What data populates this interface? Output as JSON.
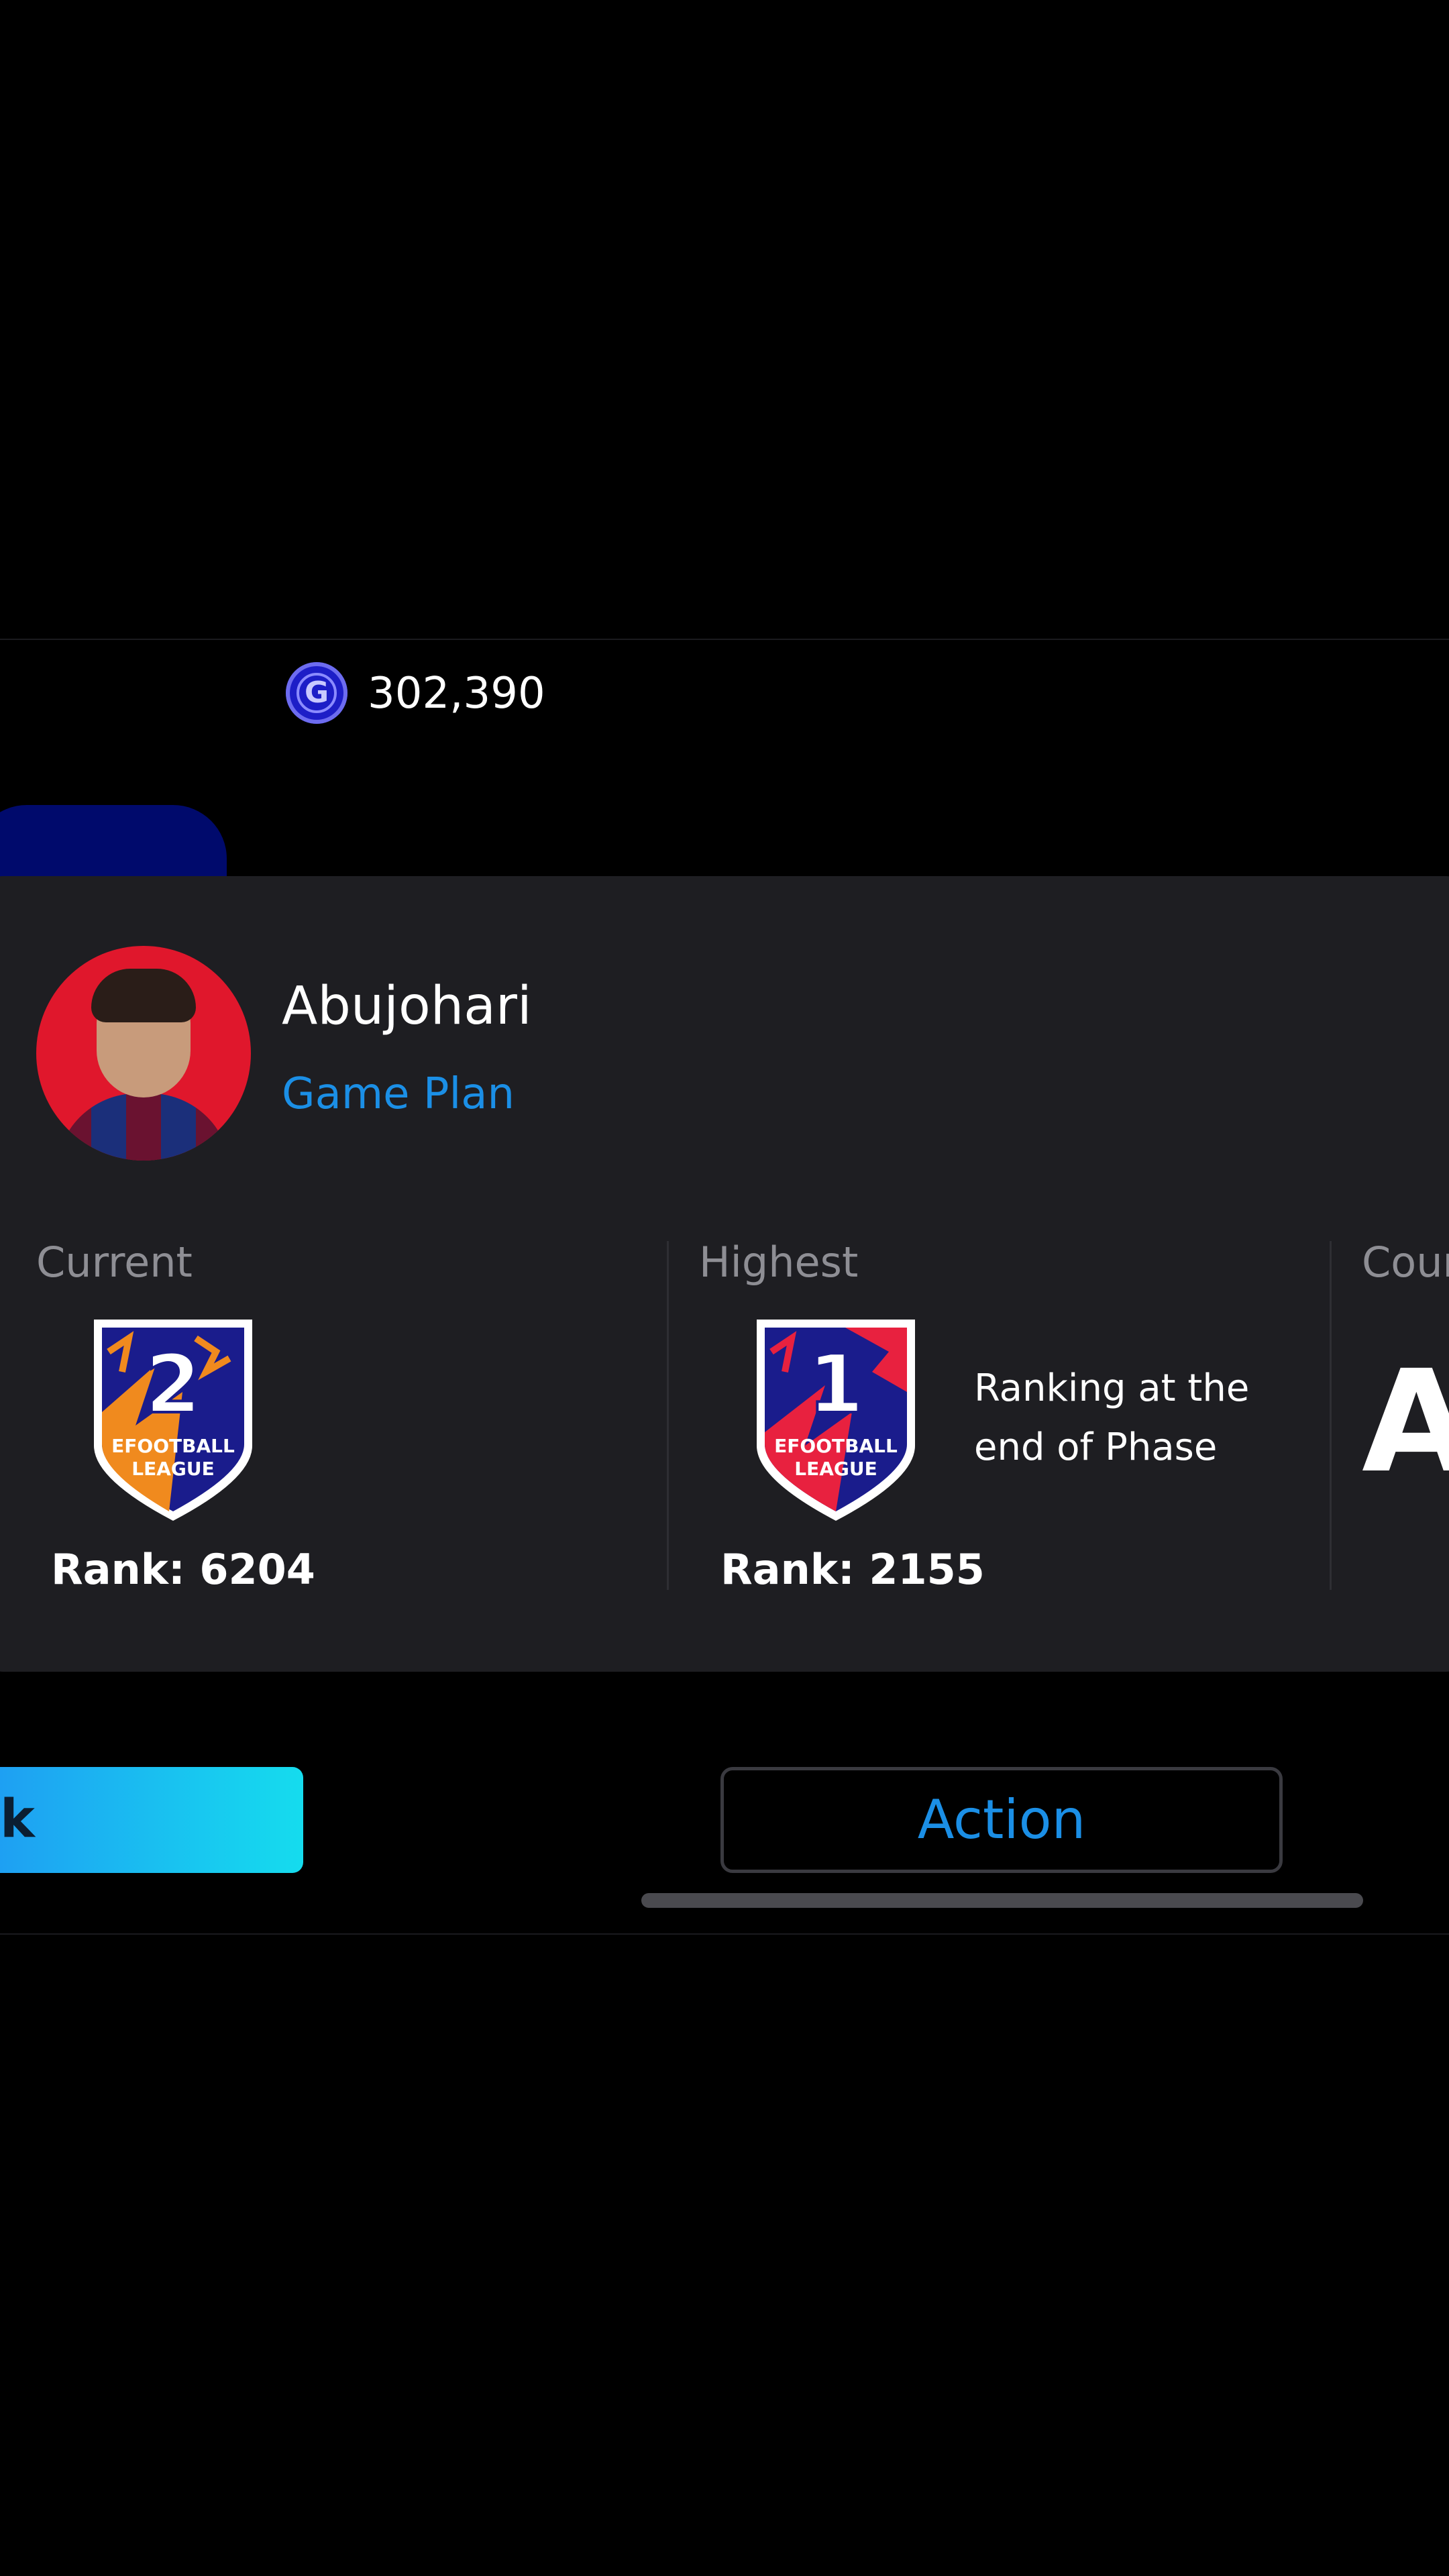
{
  "currency": {
    "icon": "gp-coin-icon",
    "symbol": "G",
    "amount": "302,390"
  },
  "profile": {
    "name": "Abujohari",
    "subtitle": "Game Plan"
  },
  "stats": {
    "current": {
      "label": "Current",
      "division": "2",
      "badge_text": "EFOOTBALL LEAGUE",
      "rank": "Rank: 6204"
    },
    "highest": {
      "label": "Highest",
      "division": "1",
      "badge_text": "EFOOTBALL LEAGUE",
      "rank": "Rank: 2155",
      "note": "Ranking at the end of Phase"
    },
    "third": {
      "label": "Cour",
      "value": "A"
    }
  },
  "buttons": {
    "primary": "k",
    "action": "Action"
  },
  "colors": {
    "background": "#000000",
    "card": "#1e1e22",
    "accent_blue": "#1b8fe6",
    "label_gray": "#8e8e94"
  }
}
